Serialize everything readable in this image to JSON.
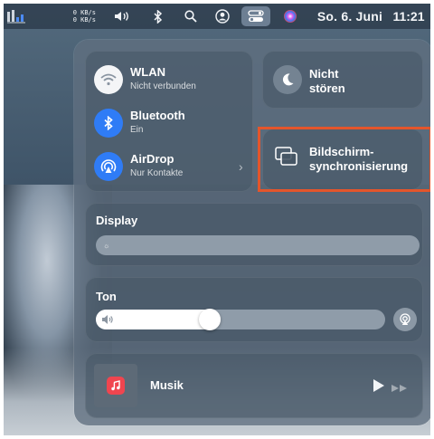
{
  "menubar": {
    "net_up": "0 KB/s",
    "net_down": "0 KB/s",
    "date": "So. 6. Juni",
    "time": "11:21",
    "icons": [
      "stats-icon",
      "volume-icon",
      "bluetooth-icon",
      "search-icon",
      "user-switch-icon",
      "control-center-icon",
      "siri-icon"
    ]
  },
  "connectivity": {
    "wlan": {
      "label": "WLAN",
      "status": "Nicht verbunden"
    },
    "bluetooth": {
      "label": "Bluetooth",
      "status": "Ein"
    },
    "airdrop": {
      "label": "AirDrop",
      "status": "Nur Kontakte"
    }
  },
  "focus": {
    "label_line1": "Nicht",
    "label_line2": "stören"
  },
  "mirroring": {
    "label_line1": "Bildschirm-",
    "label_line2": "synchronisierung"
  },
  "display": {
    "label": "Display",
    "level": 0.0
  },
  "sound": {
    "label": "Ton",
    "level": 0.43
  },
  "music": {
    "label": "Musik"
  },
  "colors": {
    "accent_blue": "#2f7cf6",
    "highlight": "#e4552b",
    "music_red": "#f0454f"
  }
}
